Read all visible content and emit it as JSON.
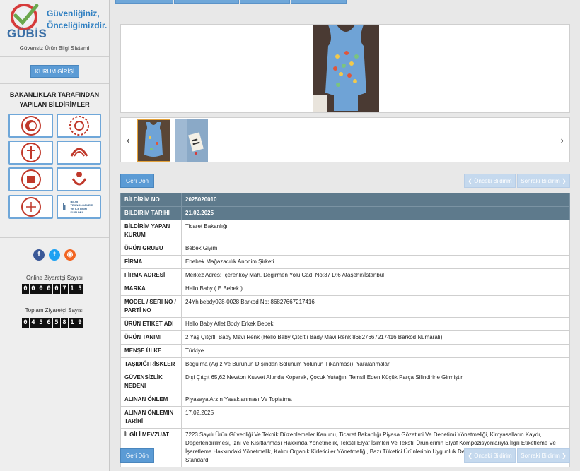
{
  "brand": {
    "name": "GÜBİS",
    "slogan_line1": "Güvenliğiniz,",
    "slogan_line2": "Önceliğimizdir.",
    "subtitle": "Güvensiz Ürün Bilgi Sistemi"
  },
  "sidebar": {
    "login_label": "KURUM GİRİŞİ",
    "section_title_line1": "BAKANLIKLAR TARAFINDAN",
    "section_title_line2": "YAPILAN BİLDİRİMLER",
    "btk_text": "BİLGİ TEKNOLOJİLERİ VE İLETİŞİM KURUMU",
    "online_label": "Online Ziyaretçi Sayısı",
    "online_digits": [
      "0",
      "0",
      "0",
      "0",
      "0",
      "7",
      "1",
      "5"
    ],
    "total_label": "Toplam Ziyaretçi Sayısı",
    "total_digits": [
      "0",
      "4",
      "5",
      "6",
      "5",
      "8",
      "1",
      "9"
    ]
  },
  "nav": {
    "back_label": "Geri Dön",
    "prev_label": "❮ Önceki Bildirim",
    "next_label": "Sonraki Bildirim ❯",
    "left_arrow": "‹",
    "right_arrow": "›"
  },
  "details": [
    {
      "key": "BİLDİRİM NO",
      "value": "2025020010",
      "header": true
    },
    {
      "key": "BİLDİRİM TARİHİ",
      "value": "21.02.2025",
      "header": true
    },
    {
      "key": "BİLDİRİM YAPAN KURUM",
      "value": "Ticaret Bakanlığı"
    },
    {
      "key": "ÜRÜN GRUBU",
      "value": "Bebek Giyim"
    },
    {
      "key": "FİRMA",
      "value": "Ebebek Mağazacılık Anonim Şirketi"
    },
    {
      "key": "FİRMA ADRESİ",
      "value": "Merkez Adres: İçerenköy Mah. Değirmen Yolu Cad. No:37 D:6 Ataşehir/İstanbul"
    },
    {
      "key": "MARKA",
      "value": "Hello Baby ( E Bebek )"
    },
    {
      "key": "MODEL / SERİ NO / PARTİ NO",
      "value": "24Yhlbebdy028-0028 Barkod No: 86827667217416"
    },
    {
      "key": "ÜRÜN ETİKET ADI",
      "value": "Hello Baby Atlet Body Erkek Bebek"
    },
    {
      "key": "ÜRÜN TANIMI",
      "value": "2 Yaş Çıtçıtlı Bady Mavi Renk (Hello Baby Çıtçıtlı Bady Mavi Renk 86827667217416 Barkod Numaralı)"
    },
    {
      "key": "MENŞE ÜLKE",
      "value": "Türkiye"
    },
    {
      "key": "TAŞIDIĞI RİSKLER",
      "value": "Boğulma (Ağız Ve Burunun Dışından Solunum Yolunun Tıkanması), Yaralanmalar"
    },
    {
      "key": "GÜVENSİZLİK NEDENİ",
      "value": "Dişi Çıtçıt 65,62 Newton Kuvvet Altında Koparak, Çocuk Yutağını Temsil Eden Küçük Parça Silindirine Girmiştir."
    },
    {
      "key": "ALINAN ÖNLEM",
      "value": "Piyasaya Arzın Yasaklanması Ve Toplatma"
    },
    {
      "key": "ALINAN ÖNLEMİN TARİHİ",
      "value": "17.02.2025"
    },
    {
      "key": "İLGİLİ MEVZUAT",
      "value": "7223 Sayılı Ürün Güvenliği Ve Teknik Düzenlemeler Kanunu, Ticaret Bakanlığı Piyasa Gözetimi Ve Denetimi Yönetmeliği, Kimyasalların Kaydı, Değerlendirilmesi, İzni Ve Kısıtlanması Hakkında Yönetmelik, Tekstil Elyaf İsimleri Ve Tekstil Ürünlerinin Elyaf Kompozisyonlarıyla İlgili Etiketleme Ve İşaretleme Hakkındaki Yönetmelik, Kalıcı Organik Kirleticiler Yönetmeliği, Bazı Tüketici Ürünlerinin Uygunluk Denetimi Tebliği Ve Tse Cen/Tr 16792 Standardı"
    }
  ]
}
